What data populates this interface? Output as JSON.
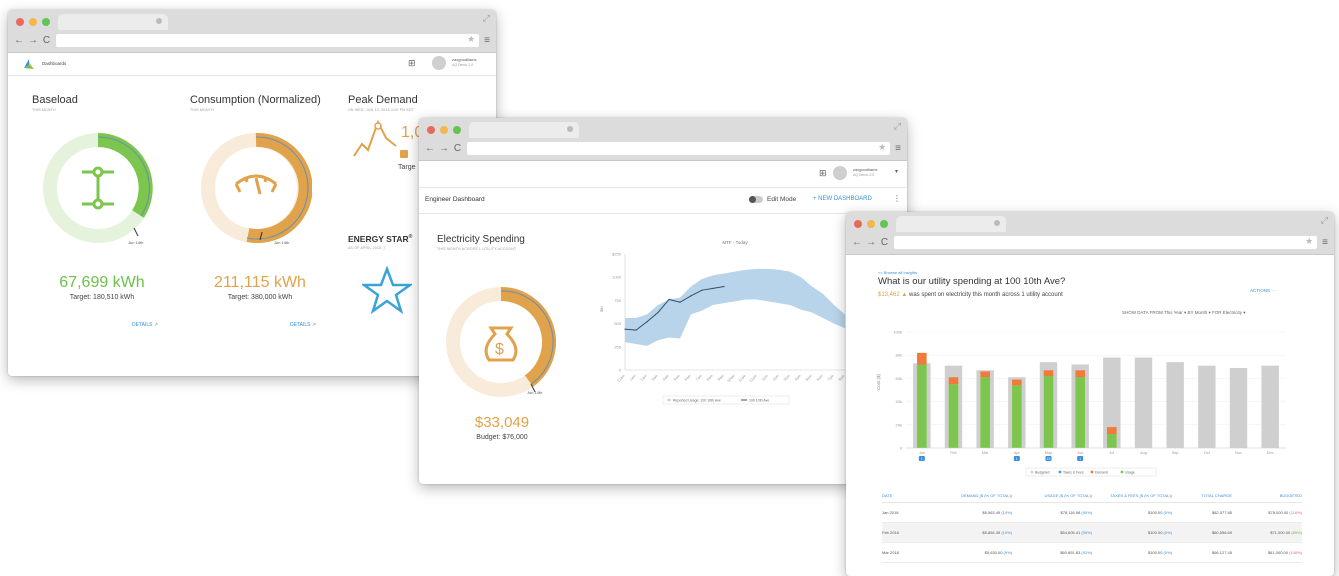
{
  "colors": {
    "green": "#7cc64d",
    "green_light": "#e6f3dc",
    "orange": "#e0a24a",
    "orange_light": "#f8ebd9",
    "blue": "#3a8fd8",
    "gray_bar": "#cfcfcf",
    "band": "#b8d4ea",
    "star": "#3aa3d8",
    "red_dot": "#e96a5a",
    "yellow_dot": "#f2b84b",
    "green_dot": "#62c454",
    "chart_orange": "#f07a3a"
  },
  "win1": {
    "app_title": "Dashboards",
    "user_name": "zaxgoodliams",
    "user_org": "AQ Demo 2.0",
    "cards": [
      {
        "title": "Baseload",
        "subtitle": "THIS MONTH",
        "value": "67,699 kWh",
        "target": "Target: 180,510 kWh",
        "marker": "Jun 14th",
        "details": "DETAILS",
        "gauge_fraction": 0.38
      },
      {
        "title": "Consumption (Normalized)",
        "subtitle": "THIS MONTH",
        "value": "211,115 kWh",
        "target": "Target: 380,000 kWh",
        "marker": "Jun 14th",
        "details": "DETAILS",
        "gauge_fraction": 0.56
      }
    ],
    "peak": {
      "title": "Peak Demand",
      "subtitle": "ON WED, JUN 13, 2018 4:00 PM EDT",
      "value": "1,0",
      "target": "Targe"
    },
    "energy": {
      "title": "ENERGY STAR",
      "reg": "®",
      "subtitle": "AS OF APRIL 2018 ⓘ"
    }
  },
  "win2": {
    "user_name": "zaxgoodliams",
    "user_org": "AQ Demo 2.0",
    "dashboard_title": "Engineer Dashboard",
    "edit_mode": "Edit Mode",
    "new_dashboard": "+ NEW DASHBOARD",
    "card": {
      "title": "Electricity Spending",
      "subtitle": "THIS MONTH ACROSS 1 UTILITY ACCOUNT",
      "value": "$33,049",
      "budget": "Budget: $76,000",
      "marker": "Jun 14th",
      "gauge_fraction": 0.43
    },
    "chart_data": {
      "type": "line",
      "title": "MTF - Today",
      "ylabel": "$/h",
      "y_ticks": [
        "$250",
        "1000",
        "750",
        "500",
        "250",
        "0"
      ],
      "ylim": [
        0,
        1250
      ],
      "x": [
        "12am",
        "1am",
        "2am",
        "3am",
        "4am",
        "5am",
        "6am",
        "7am",
        "8am",
        "9am",
        "10am",
        "11am",
        "12pm",
        "1pm",
        "2pm",
        "3pm",
        "4pm",
        "5pm",
        "6pm",
        "7pm",
        "8pm"
      ],
      "series": [
        {
          "name": "Reported Usage: 100 10th Ave",
          "values": [
            440,
            430,
            520,
            620,
            760,
            730,
            800,
            860,
            880,
            900,
            null,
            null,
            null,
            null,
            null,
            null,
            null,
            null,
            null,
            null,
            null
          ]
        }
      ],
      "band": {
        "name": "100 10th Ave",
        "lower": [
          300,
          280,
          260,
          320,
          350,
          340,
          600,
          640,
          700,
          720,
          740,
          760,
          760,
          740,
          720,
          700,
          650,
          620,
          560,
          500,
          450
        ],
        "upper": [
          560,
          560,
          600,
          700,
          760,
          780,
          900,
          980,
          1020,
          1040,
          1060,
          1080,
          1090,
          1090,
          1080,
          1060,
          1000,
          900,
          820,
          700,
          600
        ]
      },
      "legend": [
        "Reported Usage: 100 10th Ave",
        "100 10th Ave"
      ]
    }
  },
  "win3": {
    "breadcrumb": "<< Browse all Insights",
    "question": "What is our utility spending at 100 10th Ave?",
    "amount": "$13,462",
    "summary": "was spent on electricity this month across 1 utility account",
    "actions": "ACTIONS ···",
    "filter_label": "SHOW DATA FROM",
    "filter_value": "This Year",
    "by_label": "BY",
    "by_value": "Month",
    "for_label": "FOR",
    "for_value": "Electricity",
    "chart_data": {
      "type": "bar",
      "ylabel": "Cost ($)",
      "y_ticks": [
        "100k",
        "80k",
        "60k",
        "40k",
        "20k",
        "0"
      ],
      "ylim": [
        0,
        100
      ],
      "categories": [
        "Jan",
        "Feb",
        "Mar",
        "Apr",
        "May",
        "Jun",
        "Jul",
        "Aug",
        "Sep",
        "Oct",
        "Nov",
        "Dec"
      ],
      "series": [
        {
          "name": "Budgeted",
          "values": [
            73,
            71,
            67,
            61,
            74,
            72,
            78,
            78,
            74,
            71,
            69,
            71
          ]
        },
        {
          "name": "Taxes & Fees",
          "values": [
            0,
            0,
            0,
            0,
            0,
            0,
            0,
            0,
            0,
            0,
            0,
            0
          ]
        },
        {
          "name": "Demand",
          "values": [
            10,
            6,
            5,
            5,
            5,
            6,
            6,
            0,
            0,
            0,
            0,
            0
          ]
        },
        {
          "name": "Usage",
          "values": [
            72,
            55,
            61,
            54,
            62,
            61,
            12,
            0,
            0,
            0,
            0,
            0
          ]
        }
      ],
      "legend": [
        "Budgeted",
        "Taxes & Fees",
        "Demand",
        "Usage"
      ],
      "marker_badges": [
        "1",
        "",
        "",
        "1",
        "15",
        "1",
        "",
        "",
        "",
        "",
        "",
        ""
      ]
    },
    "table": {
      "headers": [
        "DATE",
        "DEMAND ($ (% OF TOTAL))",
        "USAGE ($ (% OF TOTAL))",
        "TAXES & FEES ($ (% OF TOTAL))",
        "TOTAL CHARGE",
        "BUDGETED"
      ],
      "rows": [
        {
          "date": "Jan 2018",
          "demand": "$8,563.49",
          "demand_pct": "(10%)",
          "usage": "$78,116.98",
          "usage_pct": "(90%)",
          "taxes": "$100.00",
          "taxes_pct": "(0%)",
          "total": "$82,577.85",
          "budget": "$78,000.00",
          "budget_pct": "(116%)"
        },
        {
          "date": "Feb 2018",
          "demand": "$5,854.39",
          "demand_pct": "(10%)",
          "usage": "$54,605.41",
          "usage_pct": "(90%)",
          "taxes": "$100.00",
          "taxes_pct": "(0%)",
          "total": "$60,556.69",
          "budget": "$71,000.00",
          "budget_pct": "(85%)"
        },
        {
          "date": "Mar 2018",
          "demand": "$5,630.00",
          "demand_pct": "(9%)",
          "usage": "$60,891.83",
          "usage_pct": "(91%)",
          "taxes": "$100.00",
          "taxes_pct": "(0%)",
          "total": "$66,127.45",
          "budget": "$61,000.00",
          "budget_pct": "(108%)"
        }
      ]
    }
  }
}
